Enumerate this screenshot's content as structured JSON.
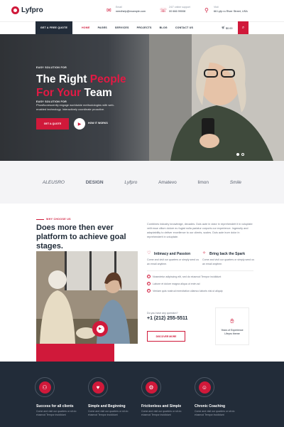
{
  "brand": {
    "name": "Lyfpro"
  },
  "contacts": [
    {
      "icon": "mail-icon",
      "label": "Email",
      "value": "needhelp@example.com"
    },
    {
      "icon": "phone-icon",
      "label": "24/7 online support",
      "value": "00 666 99008"
    },
    {
      "icon": "location-pin-icon",
      "label": "Visit",
      "value": "66 Lyfp ro River Street, USA"
    }
  ],
  "nav": {
    "quote_label": "GET A FREE QUOTE",
    "items": [
      "HOME",
      "PAGES",
      "SERVICES",
      "PROJECTS",
      "BLOG",
      "CONTACT US"
    ],
    "active": "HOME",
    "cart_count": "0",
    "cart_amount": "$0.00"
  },
  "hero": {
    "eyebrow": "EASY SOLUTION FOR",
    "title_line1_a": "The Right ",
    "title_line1_b": "People",
    "title_line2_a": "For Your",
    "title_line2_b": " Team",
    "description": "Phosfluorescently engage worldwide methodologies with web-enabled technology. Interactively coordinate proactive.",
    "cta_label": "GET A QUOTE",
    "video_label": "HOW IT WORKS"
  },
  "brands": [
    "ALEUSRO",
    "DESIGN",
    "Lyfpro",
    "Amatevo",
    "limon",
    "Smile"
  ],
  "about": {
    "eyebrow": "WHY CHOOSE US",
    "title": "Does more then ever platform to achieve goal stages.",
    "paragraph": "Combines industry knowledge, decades. Duis aute in dolor in reprehendeit it in voluptate velit esse cillum dolore eu fugiat nulla pariatur corporis our experience. Ingenuity and adaptability to deliver excellence to our clients, scales. Duis aute irure dolor in reprehenderit in voluptate.",
    "features": [
      {
        "icon": "heart-icon",
        "title": "Intimacy and Passion",
        "desc": "Come and visit our quarters or simply send us an email anytime."
      },
      {
        "icon": "spark-icon",
        "title": "Bring back the Spark",
        "desc": "Come and visit our quarters or simply send us an email anytime."
      }
    ],
    "checks": [
      "Nosectetur adipiscing elit, sed do eiusmod Tempor incididunt",
      "Labore et dolore magna aliqua ut enim ad",
      "Veniam quis nostrud exercitation ullamco laboris nisi ut aliquip"
    ],
    "phone_label": "Do you have any question?",
    "phone": "+1 (212) 255-5511",
    "discover_label": "DISCOVER MORE",
    "experience": "Years of Experience Lifepro theme"
  },
  "services": [
    {
      "icon": "hands-icon",
      "title": "Success for all clients",
      "desc": "Come and visit our quarters or sit do eiusmod Tempor incididunt"
    },
    {
      "icon": "people-icon",
      "title": "Simple and Beginning",
      "desc": "Come and visit our quarters or sit do eiusmod Tempor incididunt"
    },
    {
      "icon": "gears-icon",
      "title": "Frictionless and Simple",
      "desc": "Come and visit our quarters or sit do eiusmod Tempor incididunt"
    },
    {
      "icon": "coach-icon",
      "title": "Chronic Coaching",
      "desc": "Come and visit our quarters or sit do eiusmod Tempor incididunt"
    }
  ],
  "colors": {
    "accent": "#d0193a",
    "dark": "#222c39"
  }
}
